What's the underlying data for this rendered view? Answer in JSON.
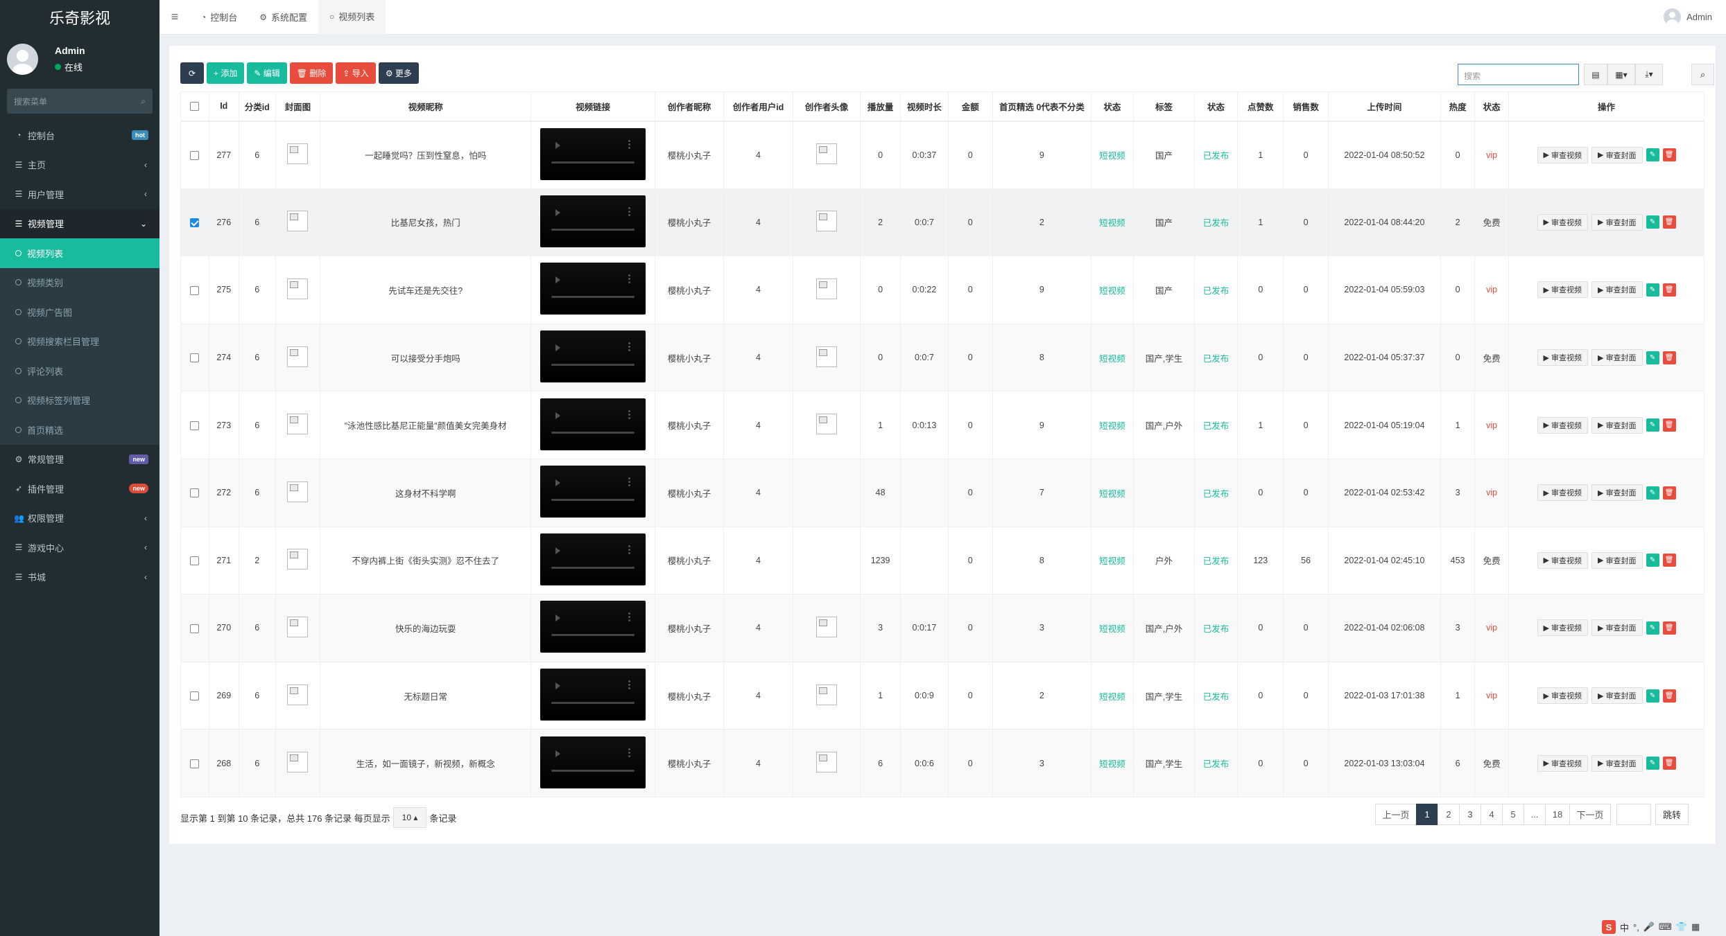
{
  "app": {
    "title": "乐奇影视"
  },
  "user": {
    "name": "Admin",
    "status": "在线"
  },
  "sidebar": {
    "search_placeholder": "搜索菜单",
    "items": [
      {
        "label": "控制台",
        "icon": "dashboard-icon",
        "badge": "hot"
      },
      {
        "label": "主页",
        "icon": "list-icon",
        "arrow": "‹"
      },
      {
        "label": "用户管理",
        "icon": "list-icon",
        "arrow": "‹"
      },
      {
        "label": "视频管理",
        "icon": "list-icon",
        "arrow": "⌄"
      }
    ],
    "sub_items": [
      "视频列表",
      "视频类别",
      "视频广告图",
      "视频搜索栏目管理",
      "评论列表",
      "视频标签列管理",
      "首页精选"
    ],
    "bottom_items": [
      {
        "label": "常规管理",
        "icon": "cogs-icon",
        "badge": "new"
      },
      {
        "label": "插件管理",
        "icon": "rocket-icon",
        "badge": "new"
      },
      {
        "label": "权限管理",
        "icon": "group-icon",
        "arrow": "‹"
      },
      {
        "label": "游戏中心",
        "icon": "list-icon",
        "arrow": "‹"
      },
      {
        "label": "书城",
        "icon": "list-icon",
        "arrow": "‹"
      }
    ]
  },
  "topnav": {
    "tabs": [
      "控制台",
      "系统配置",
      "视频列表"
    ],
    "user": "Admin"
  },
  "toolbar": {
    "add": "添加",
    "edit": "编辑",
    "delete": "删除",
    "import": "导入",
    "more": "更多",
    "search_placeholder": "搜索"
  },
  "table": {
    "headers": [
      "Id",
      "分类id",
      "封面图",
      "视频昵称",
      "视频链接",
      "创作者昵称",
      "创作者用户id",
      "创作者头像",
      "播放量",
      "视频时长",
      "金额",
      "首页精选 0代表不分类",
      "状态",
      "标签",
      "状态",
      "点赞数",
      "销售数",
      "上传时间",
      "热度",
      "状态",
      "操作"
    ],
    "op_review_video": "审查视频",
    "op_review_cover": "审查封面",
    "rows": [
      {
        "id": "277",
        "cat": "6",
        "title": "一起睡觉吗？压到性窒息，怕吗",
        "creator": "樱桃小丸子",
        "uid": "4",
        "avatar": true,
        "plays": "0",
        "dur": "0:0:37",
        "amount": "0",
        "featured": "9",
        "type": "短视频",
        "tags": "国产",
        "pub": "已发布",
        "likes": "1",
        "sales": "0",
        "time": "2022-01-04 08:50:52",
        "heat": "0",
        "vip": "vip",
        "checked": false
      },
      {
        "id": "276",
        "cat": "6",
        "title": "比基尼女孩，热门",
        "creator": "樱桃小丸子",
        "uid": "4",
        "avatar": true,
        "plays": "2",
        "dur": "0:0:7",
        "amount": "0",
        "featured": "2",
        "type": "短视频",
        "tags": "国产",
        "pub": "已发布",
        "likes": "1",
        "sales": "0",
        "time": "2022-01-04 08:44:20",
        "heat": "2",
        "vip": "免费",
        "checked": true
      },
      {
        "id": "275",
        "cat": "6",
        "title": "先试车还是先交往?",
        "creator": "樱桃小丸子",
        "uid": "4",
        "avatar": true,
        "plays": "0",
        "dur": "0:0:22",
        "amount": "0",
        "featured": "9",
        "type": "短视频",
        "tags": "国产",
        "pub": "已发布",
        "likes": "0",
        "sales": "0",
        "time": "2022-01-04 05:59:03",
        "heat": "0",
        "vip": "vip",
        "checked": false
      },
      {
        "id": "274",
        "cat": "6",
        "title": "可以接受分手炮吗",
        "creator": "樱桃小丸子",
        "uid": "4",
        "avatar": true,
        "plays": "0",
        "dur": "0:0:7",
        "amount": "0",
        "featured": "8",
        "type": "短视频",
        "tags": "国产,学生",
        "pub": "已发布",
        "likes": "0",
        "sales": "0",
        "time": "2022-01-04 05:37:37",
        "heat": "0",
        "vip": "免费",
        "checked": false
      },
      {
        "id": "273",
        "cat": "6",
        "title": "\"泳池性感比基尼正能量\"颜值美女完美身材",
        "creator": "樱桃小丸子",
        "uid": "4",
        "avatar": true,
        "plays": "1",
        "dur": "0:0:13",
        "amount": "0",
        "featured": "9",
        "type": "短视频",
        "tags": "国产,户外",
        "pub": "已发布",
        "likes": "1",
        "sales": "0",
        "time": "2022-01-04 05:19:04",
        "heat": "1",
        "vip": "vip",
        "checked": false
      },
      {
        "id": "272",
        "cat": "6",
        "title": "这身材不科学啊",
        "creator": "樱桃小丸子",
        "uid": "4",
        "avatar": false,
        "plays": "48",
        "dur": "",
        "amount": "0",
        "featured": "7",
        "type": "短视频",
        "tags": "",
        "pub": "已发布",
        "likes": "0",
        "sales": "0",
        "time": "2022-01-04 02:53:42",
        "heat": "3",
        "vip": "vip",
        "checked": false
      },
      {
        "id": "271",
        "cat": "2",
        "title": "不穿内裤上街《街头实测》忍不住去了",
        "creator": "樱桃小丸子",
        "uid": "4",
        "avatar": false,
        "plays": "1239",
        "dur": "",
        "amount": "0",
        "featured": "8",
        "type": "短视频",
        "tags": "户外",
        "pub": "已发布",
        "likes": "123",
        "sales": "56",
        "time": "2022-01-04 02:45:10",
        "heat": "453",
        "vip": "免费",
        "checked": false
      },
      {
        "id": "270",
        "cat": "6",
        "title": "快乐的海边玩耍",
        "creator": "樱桃小丸子",
        "uid": "4",
        "avatar": true,
        "plays": "3",
        "dur": "0:0:17",
        "amount": "0",
        "featured": "3",
        "type": "短视频",
        "tags": "国产,户外",
        "pub": "已发布",
        "likes": "0",
        "sales": "0",
        "time": "2022-01-04 02:06:08",
        "heat": "3",
        "vip": "vip",
        "checked": false
      },
      {
        "id": "269",
        "cat": "6",
        "title": "无标题日常",
        "creator": "樱桃小丸子",
        "uid": "4",
        "avatar": true,
        "plays": "1",
        "dur": "0:0:9",
        "amount": "0",
        "featured": "2",
        "type": "短视频",
        "tags": "国产,学生",
        "pub": "已发布",
        "likes": "0",
        "sales": "0",
        "time": "2022-01-03 17:01:38",
        "heat": "1",
        "vip": "vip",
        "checked": false
      },
      {
        "id": "268",
        "cat": "6",
        "title": "生活，如一面镜子，新视频，新概念",
        "creator": "樱桃小丸子",
        "uid": "4",
        "avatar": true,
        "plays": "6",
        "dur": "0:0:6",
        "amount": "0",
        "featured": "3",
        "type": "短视频",
        "tags": "国产,学生",
        "pub": "已发布",
        "likes": "0",
        "sales": "0",
        "time": "2022-01-03 13:03:04",
        "heat": "6",
        "vip": "免费",
        "checked": false
      }
    ]
  },
  "pagination": {
    "info_prefix": "显示第 1 到第 10 条记录，总共 176 条记录 每页显示",
    "page_size": "10",
    "info_suffix": "条记录",
    "prev": "上一页",
    "pages": [
      "1",
      "2",
      "3",
      "4",
      "5",
      "...",
      "18"
    ],
    "current": "1",
    "next": "下一页",
    "go": "跳转"
  },
  "ime": {
    "logo": "S",
    "mode": "中"
  }
}
